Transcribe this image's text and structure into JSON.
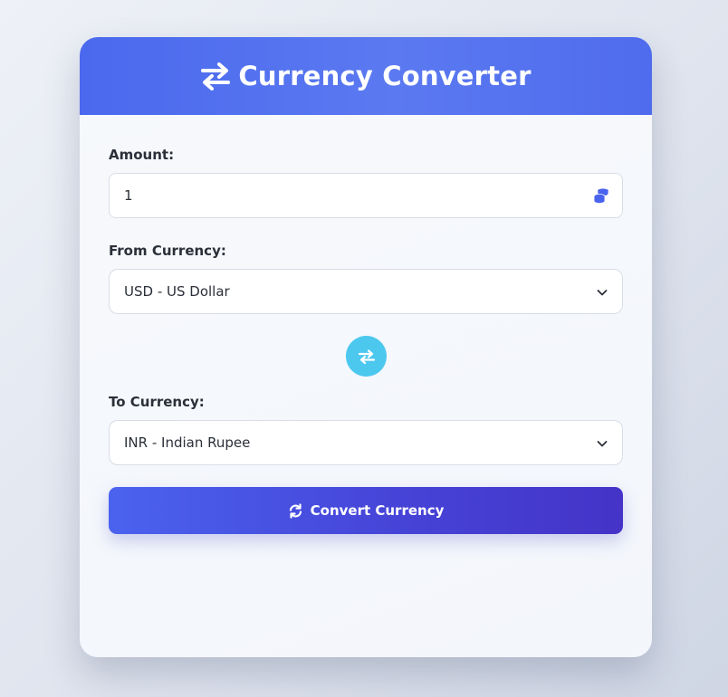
{
  "header": {
    "title": "Currency Converter",
    "icon": "exchange-arrows-icon"
  },
  "amount": {
    "label": "Amount:",
    "value": "1",
    "icon": "coins-icon"
  },
  "from_currency": {
    "label": "From Currency:",
    "selected": "USD - US Dollar"
  },
  "swap": {
    "icon": "swap-arrows-icon"
  },
  "to_currency": {
    "label": "To Currency:",
    "selected": "INR - Indian Rupee"
  },
  "convert_button": {
    "label": "Convert Currency",
    "icon": "sync-icon"
  },
  "colors": {
    "header": "#5273f0",
    "accent": "#4a63ee",
    "swap_button": "#4cc8ef",
    "text": "#2b2f38"
  }
}
